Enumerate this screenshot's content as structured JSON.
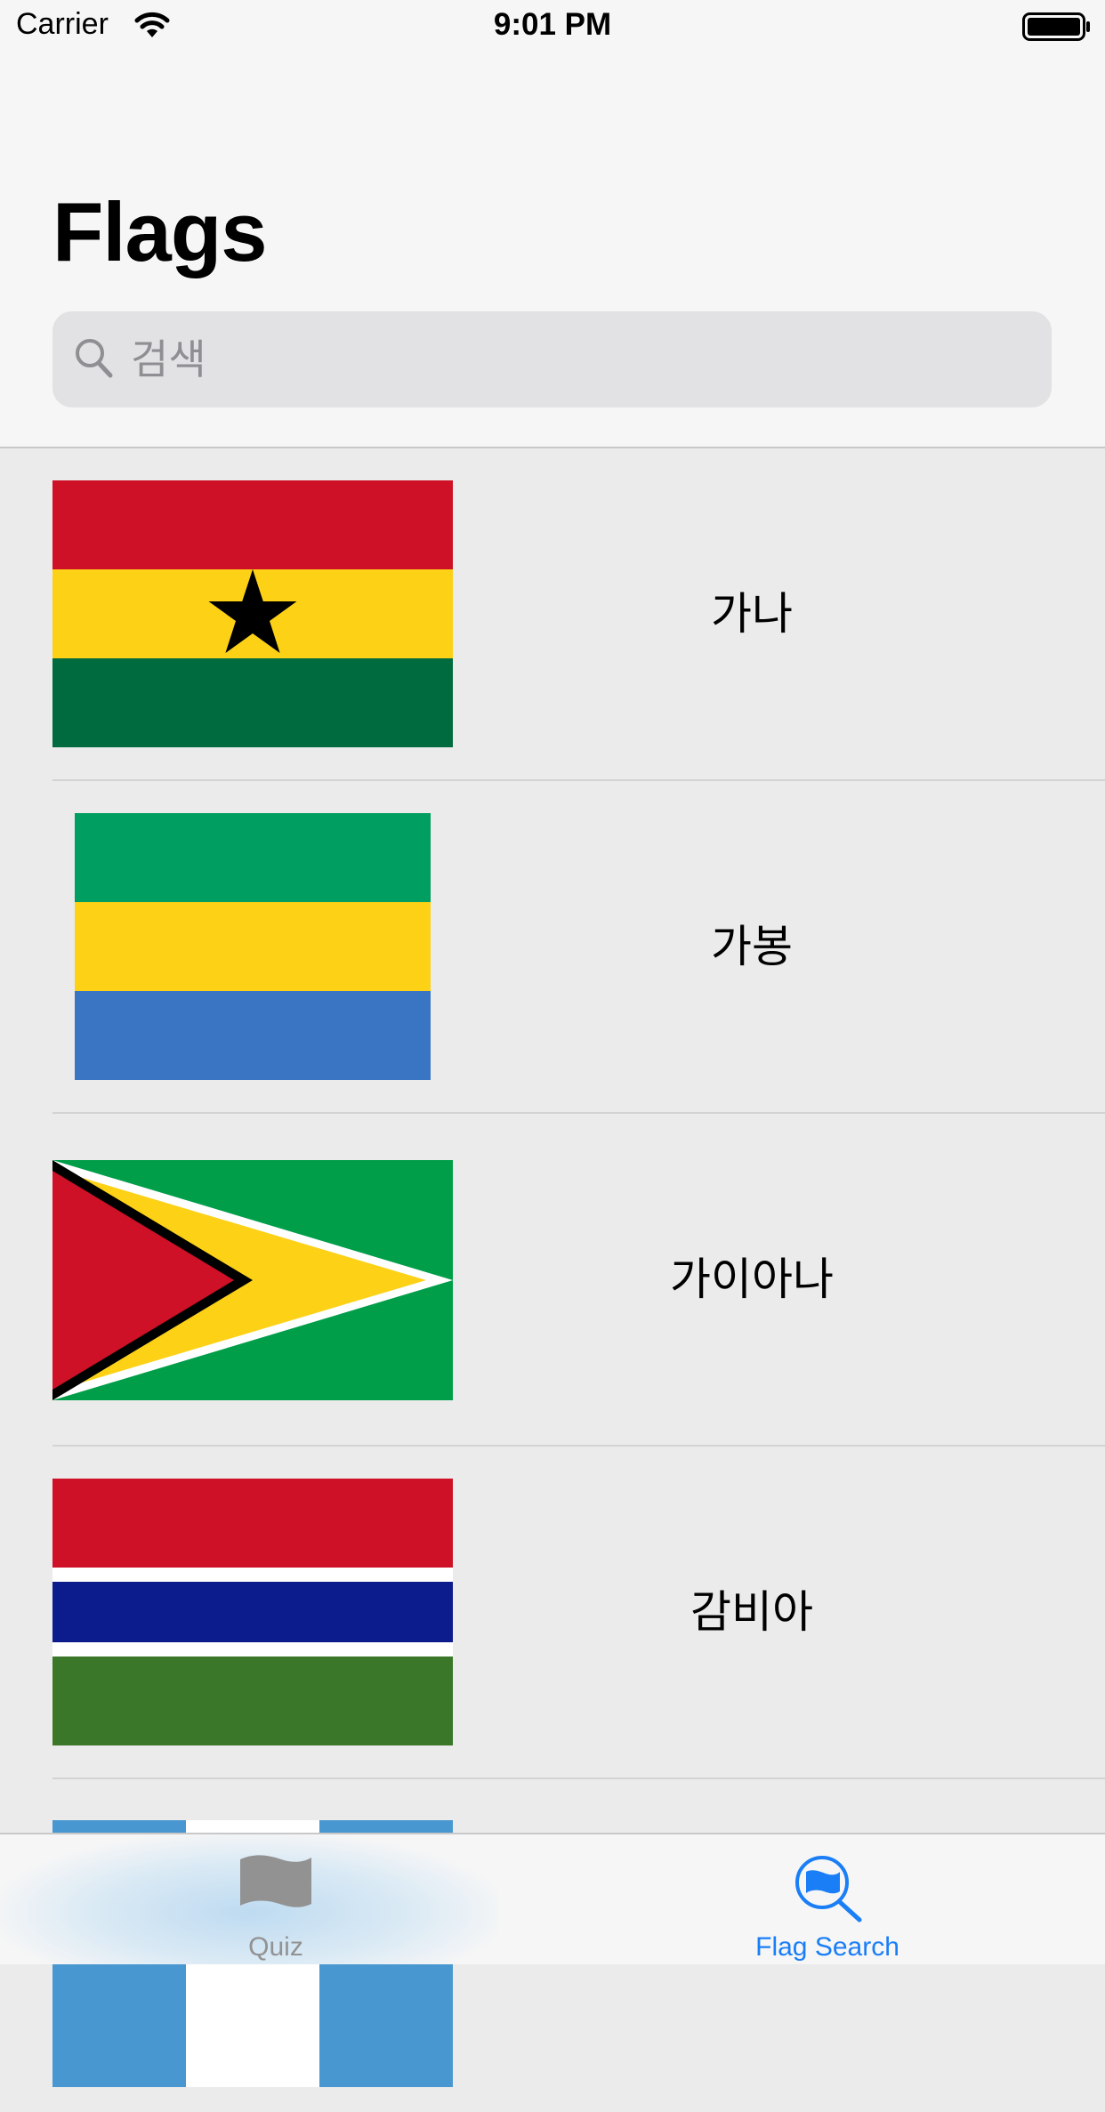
{
  "status_bar": {
    "carrier": "Carrier",
    "time": "9:01 PM"
  },
  "header": {
    "title": "Flags"
  },
  "search": {
    "placeholder": "검색"
  },
  "countries": [
    {
      "name": "가나",
      "flag": "ghana-flag"
    },
    {
      "name": "가봉",
      "flag": "gabon-flag"
    },
    {
      "name": "가이아나",
      "flag": "guyana-flag"
    },
    {
      "name": "감비아",
      "flag": "gambia-flag"
    },
    {
      "name": "",
      "flag": "guatemala-flag"
    }
  ],
  "tab_bar": {
    "tabs": [
      {
        "label": "Quiz",
        "icon": "flag-icon",
        "selected": false
      },
      {
        "label": "Flag Search",
        "icon": "flag-search-icon",
        "selected": true
      }
    ]
  },
  "colors": {
    "accent": "#1a7ef6",
    "inactive_tab": "#929292"
  }
}
